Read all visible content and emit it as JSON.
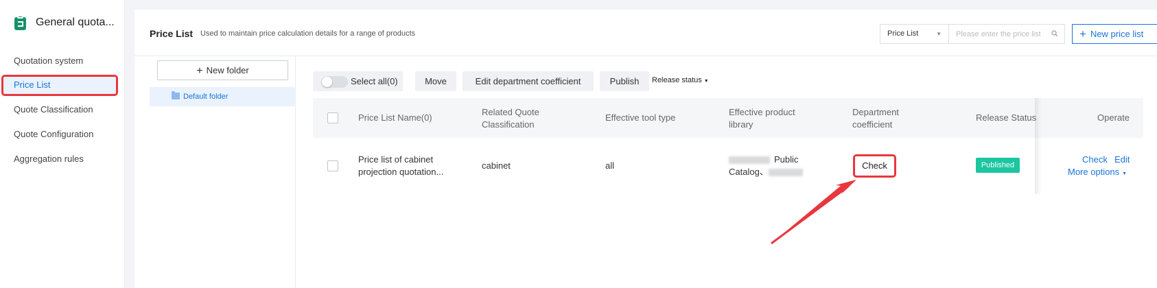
{
  "sidebar": {
    "app_title": "General quota...",
    "items": [
      {
        "label": "Quotation system",
        "active": false
      },
      {
        "label": "Price List",
        "active": true
      },
      {
        "label": "Quote Classification",
        "active": false
      },
      {
        "label": "Quote Configuration",
        "active": false
      },
      {
        "label": "Aggregation rules",
        "active": false
      }
    ]
  },
  "header": {
    "title": "Price List",
    "description": "Used to maintain price calculation details for a range of products",
    "filter_select": "Price List",
    "search_placeholder": "Please enter the price list",
    "new_price_list": "New price list"
  },
  "folders": {
    "new_folder": "New folder",
    "items": [
      "Default folder"
    ]
  },
  "toolbar": {
    "select_all": "Select all(0)",
    "move": "Move",
    "edit_department_coefficient": "Edit department coefficient",
    "publish": "Publish",
    "release_status": "Release status"
  },
  "table": {
    "columns": {
      "name": "Price List Name(0)",
      "classification_1": "Related Quote",
      "classification_2": "Classification",
      "tool_type": "Effective tool type",
      "library_1": "Effective product",
      "library_2": "library",
      "coefficient_1": "Department",
      "coefficient_2": "coefficient",
      "release_status": "Release Status",
      "operate": "Operate"
    },
    "rows": [
      {
        "name_1": "Price list of cabinet",
        "name_2": "projection quotation...",
        "classification": "cabinet",
        "tool_type": "all",
        "library_1": "Public",
        "library_2": "Catalog、",
        "coefficient": "Check",
        "release_status": "Published",
        "op_check": "Check",
        "op_edit": "Edit",
        "op_more": "More options"
      }
    ]
  },
  "colors": {
    "accent": "#1a73d9",
    "highlight_annotation": "#e8363d",
    "published_badge": "#1bc6a0",
    "brand_green": "#17916b"
  }
}
